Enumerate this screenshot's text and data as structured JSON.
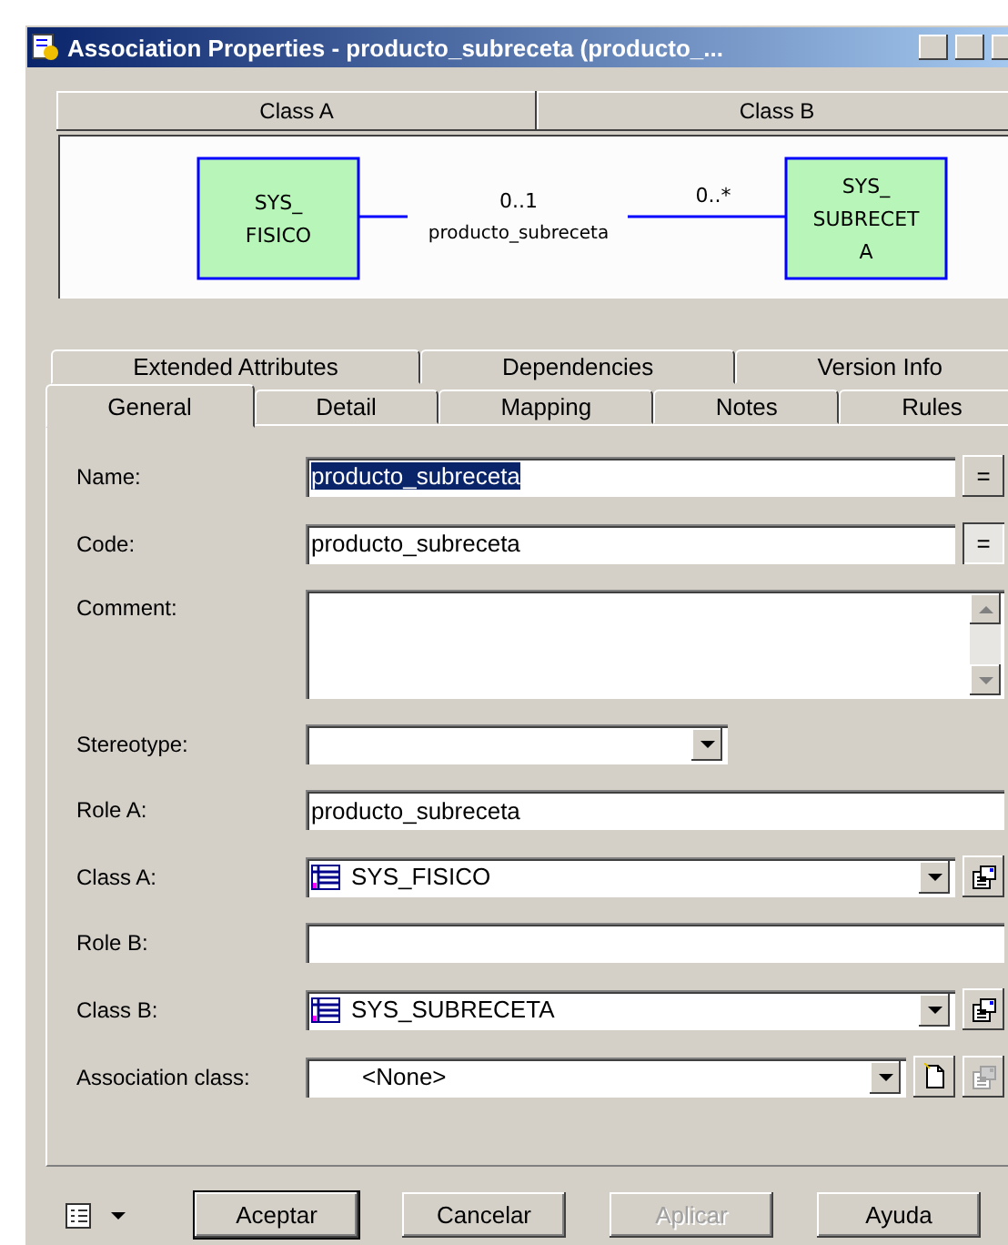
{
  "window": {
    "title": "Association Properties - producto_subreceta (producto_..."
  },
  "class_headers": [
    "Class A",
    "Class B"
  ],
  "diagram": {
    "class_a": [
      "SYS_",
      "FISICO"
    ],
    "class_b": [
      "SYS_",
      "SUBRECET",
      "A"
    ],
    "multiplicity_a": "0..1",
    "multiplicity_b": "0..*",
    "association_name": "producto_subreceta"
  },
  "tabs": {
    "back_row": [
      {
        "label": "Extended Attributes",
        "selected": false
      },
      {
        "label": "Dependencies",
        "selected": false
      },
      {
        "label": "Version Info",
        "selected": false
      }
    ],
    "front_row": [
      {
        "label": "General",
        "selected": true
      },
      {
        "label": "Detail",
        "selected": false
      },
      {
        "label": "Mapping",
        "selected": false
      },
      {
        "label": "Notes",
        "selected": false
      },
      {
        "label": "Rules",
        "selected": false
      }
    ]
  },
  "fields": [
    {
      "kind": "text",
      "label": "Name:",
      "value": "producto_subreceta",
      "highlighted": true,
      "buttons": [
        {
          "kind": "equals",
          "text": "=",
          "pressed": false
        }
      ]
    },
    {
      "kind": "text",
      "label": "Code:",
      "value": "producto_subreceta",
      "highlighted": false,
      "buttons": [
        {
          "kind": "equals",
          "text": "=",
          "pressed": true
        }
      ]
    },
    {
      "kind": "textarea",
      "label": "Comment:"
    },
    {
      "kind": "short_combo",
      "label": "Stereotype:"
    },
    {
      "kind": "text",
      "label": "Role A:",
      "value": "producto_subreceta",
      "highlighted": false
    },
    {
      "kind": "object",
      "label": "Class A:",
      "value": "SYS_FISICO",
      "buttons": [
        {
          "kind": "properties",
          "disabled": false
        }
      ]
    },
    {
      "kind": "text",
      "label": "Role B:"
    },
    {
      "kind": "object",
      "label": "Class B:",
      "value": "SYS_SUBRECETA",
      "buttons": [
        {
          "kind": "properties",
          "disabled": false
        }
      ]
    },
    {
      "kind": "combo",
      "label": "Association class:",
      "value": "<None>",
      "buttons": [
        {
          "kind": "new",
          "disabled": false
        },
        {
          "kind": "properties",
          "disabled": true
        }
      ]
    }
  ],
  "buttons": [
    {
      "label": "Aceptar",
      "default": true,
      "disabled": false
    },
    {
      "label": "Cancelar",
      "default": false,
      "disabled": false
    },
    {
      "label": "Aplicar",
      "default": false,
      "disabled": true
    },
    {
      "label": "Ayuda",
      "default": false,
      "disabled": false
    }
  ]
}
